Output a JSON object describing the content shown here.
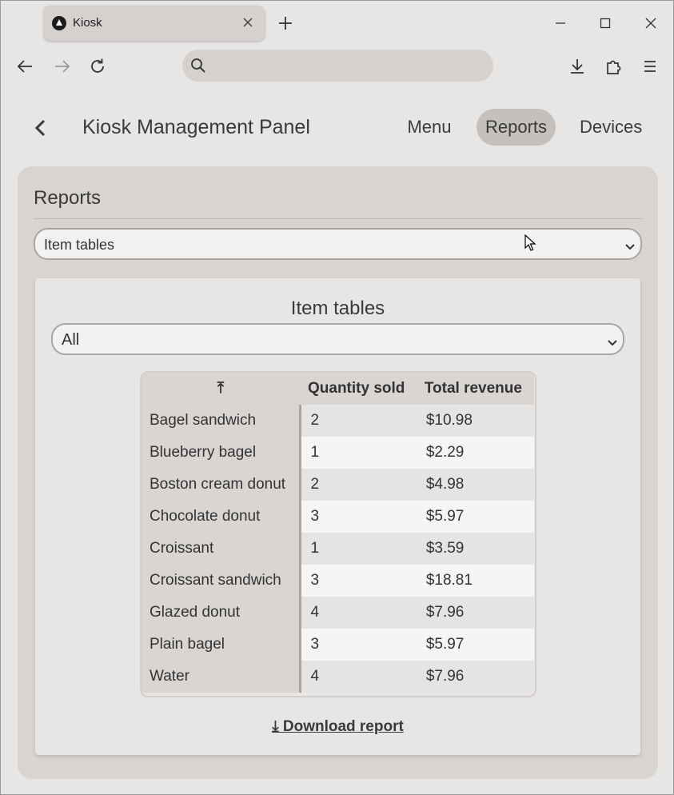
{
  "browser": {
    "tab_title": "Kiosk",
    "url_value": "",
    "url_placeholder": ""
  },
  "icons": {
    "favicon": "kiosk-logo-icon",
    "close_tab": "close-icon",
    "new_tab": "plus-icon",
    "back": "arrow-left-icon",
    "forward": "arrow-right-icon",
    "reload": "reload-icon",
    "search": "search-icon",
    "download": "download-icon",
    "extensions": "puzzle-icon",
    "menu": "hamburger-icon",
    "app_back": "chevron-left-icon",
    "sort": "sort-icon"
  },
  "app": {
    "title": "Kiosk Management Panel",
    "nav": [
      "Menu",
      "Reports",
      "Devices"
    ],
    "active_nav": "Reports"
  },
  "reports": {
    "heading": "Reports",
    "report_type": "Item tables",
    "panel_title": "Item tables",
    "filter": "All",
    "table": {
      "sort_header": "⤒",
      "columns": [
        "Quantity sold",
        "Total revenue"
      ],
      "rows": [
        {
          "item": "Bagel sandwich",
          "qty": "2",
          "revenue": "$10.98"
        },
        {
          "item": "Blueberry bagel",
          "qty": "1",
          "revenue": "$2.29"
        },
        {
          "item": "Boston cream donut",
          "qty": "2",
          "revenue": "$4.98"
        },
        {
          "item": "Chocolate donut",
          "qty": "3",
          "revenue": "$5.97"
        },
        {
          "item": "Croissant",
          "qty": "1",
          "revenue": "$3.59"
        },
        {
          "item": "Croissant sandwich",
          "qty": "3",
          "revenue": "$18.81"
        },
        {
          "item": "Glazed donut",
          "qty": "4",
          "revenue": "$7.96"
        },
        {
          "item": "Plain bagel",
          "qty": "3",
          "revenue": "$5.97"
        },
        {
          "item": "Water",
          "qty": "4",
          "revenue": "$7.96"
        }
      ]
    },
    "download_label": "⤓ Download report"
  },
  "colors": {
    "window_bg": "#e8e6e5",
    "card_bg": "#d8d4d1",
    "active_nav_bg": "#c4c0bd"
  }
}
